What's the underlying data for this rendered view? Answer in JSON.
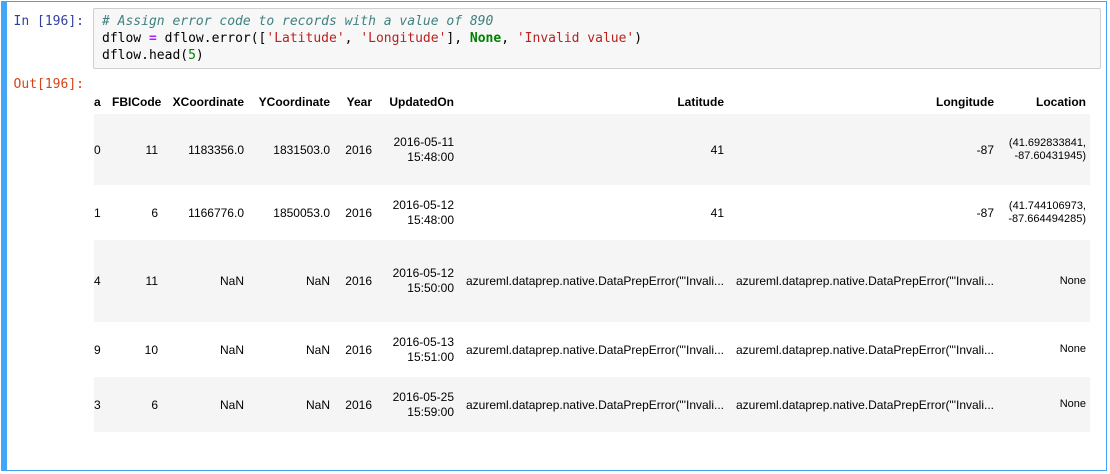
{
  "cell": {
    "in_prompt": "In [196]:",
    "out_prompt": "Out[196]:",
    "code": {
      "comment": "# Assign error code to records with a value of 890",
      "line2": {
        "lhs": "dflow ",
        "op": "=",
        "rhs_a": " dflow.error([",
        "str1": "'Latitude'",
        "sep": ", ",
        "str2": "'Longitude'",
        "rhs_b": "], ",
        "kw": "None",
        "sep2": ", ",
        "str3": "'Invalid value'",
        "close": ")"
      },
      "line3": {
        "a": "dflow.head(",
        "num": "5",
        "b": ")"
      }
    }
  },
  "table": {
    "headers": [
      "a",
      "FBICode",
      "XCoordinate",
      "YCoordinate",
      "Year",
      "UpdatedOn",
      "Latitude",
      "Longitude",
      "Location"
    ],
    "rows": [
      {
        "a": "0",
        "FBICode": "11",
        "XCoordinate": "1183356.0",
        "YCoordinate": "1831503.0",
        "Year": "2016",
        "UpdatedOn_date": "2016-05-11",
        "UpdatedOn_time": "15:48:00",
        "Latitude": "41",
        "Longitude": "-87",
        "Location_l1": "(41.692833841,",
        "Location_l2": "-87.60431945)"
      },
      {
        "a": "1",
        "FBICode": "6",
        "XCoordinate": "1166776.0",
        "YCoordinate": "1850053.0",
        "Year": "2016",
        "UpdatedOn_date": "2016-05-12",
        "UpdatedOn_time": "15:48:00",
        "Latitude": "41",
        "Longitude": "-87",
        "Location_l1": "(41.744106973,",
        "Location_l2": "-87.664494285)"
      },
      {
        "a": "4",
        "FBICode": "11",
        "XCoordinate": "NaN",
        "YCoordinate": "NaN",
        "Year": "2016",
        "UpdatedOn_date": "2016-05-12",
        "UpdatedOn_time": "15:50:00",
        "Latitude": "azureml.dataprep.native.DataPrepError(\"'Invali...",
        "Longitude": "azureml.dataprep.native.DataPrepError(\"'Invali...",
        "Location_l1": "None",
        "Location_l2": ""
      },
      {
        "a": "9",
        "FBICode": "10",
        "XCoordinate": "NaN",
        "YCoordinate": "NaN",
        "Year": "2016",
        "UpdatedOn_date": "2016-05-13",
        "UpdatedOn_time": "15:51:00",
        "Latitude": "azureml.dataprep.native.DataPrepError(\"'Invali...",
        "Longitude": "azureml.dataprep.native.DataPrepError(\"'Invali...",
        "Location_l1": "None",
        "Location_l2": ""
      },
      {
        "a": "3",
        "FBICode": "6",
        "XCoordinate": "NaN",
        "YCoordinate": "NaN",
        "Year": "2016",
        "UpdatedOn_date": "2016-05-25",
        "UpdatedOn_time": "15:59:00",
        "Latitude": "azureml.dataprep.native.DataPrepError(\"'Invali...",
        "Longitude": "azureml.dataprep.native.DataPrepError(\"'Invali...",
        "Location_l1": "None",
        "Location_l2": ""
      }
    ]
  }
}
